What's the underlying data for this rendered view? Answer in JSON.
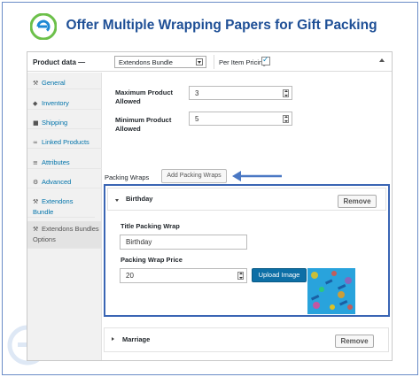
{
  "banner": {
    "title": "Offer Multiple Wrapping Papers for Gift Packing"
  },
  "product_data": {
    "label": "Product data —",
    "product_type": "Extendons Bundle",
    "per_item_pricing_label": "Per Item Pricing:",
    "per_item_pricing_checked": true
  },
  "sidebar": {
    "items": [
      {
        "label": "General",
        "icon": "wrench-icon",
        "glyph": "⚒"
      },
      {
        "label": "Inventory",
        "icon": "inventory-icon",
        "glyph": "◆"
      },
      {
        "label": "Shipping",
        "icon": "truck-icon",
        "glyph": "■"
      },
      {
        "label": "Linked Products",
        "icon": "link-icon",
        "glyph": "∞"
      },
      {
        "label": "Attributes",
        "icon": "list-icon",
        "glyph": "≡"
      },
      {
        "label": "Advanced",
        "icon": "gear-icon",
        "glyph": "⚙"
      },
      {
        "label": "Extendons Bundle",
        "icon": "wrench-icon",
        "glyph": "⚒"
      },
      {
        "label": "Extendons Bundles Options",
        "icon": "wrench-icon",
        "glyph": "⚒"
      }
    ]
  },
  "fields": {
    "max_label": "Maximum Product Allowed",
    "max_value": "3",
    "min_label": "Minimum Product Allowed",
    "min_value": "5"
  },
  "packing": {
    "label": "Packing Wraps",
    "add_button": "Add Packing Wraps",
    "wraps": [
      {
        "name": "Birthday",
        "remove_label": "Remove",
        "title_label": "Title Packing Wrap",
        "title_value": "Birthday",
        "price_label": "Packing Wrap Price",
        "price_value": "20",
        "upload_label": "Upload Image"
      },
      {
        "name": "Marriage",
        "remove_label": "Remove"
      }
    ]
  },
  "colors": {
    "accent": "#3a65b4",
    "title": "#1e4f96",
    "link": "#0073aa",
    "upload_button": "#0d6fa6"
  }
}
